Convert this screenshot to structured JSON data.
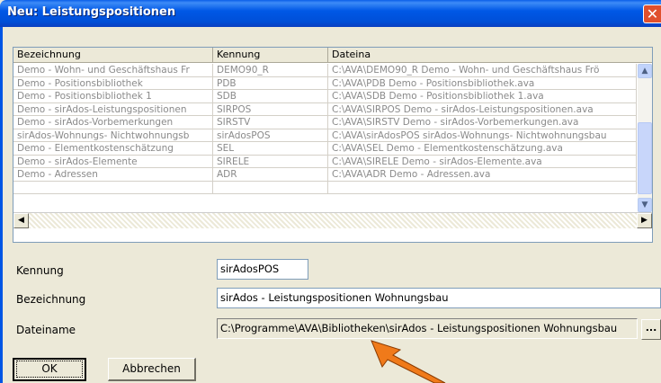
{
  "window": {
    "title": "Neu: Leistungspositionen",
    "close_glyph": "✕"
  },
  "list": {
    "columns": [
      "Bezeichnung",
      "Kennung",
      "Dateina"
    ],
    "rows": [
      [
        "Demo - Wohn- und Geschäftshaus Fr",
        "DEMO90_R",
        "C:\\AVA\\DEMO90_R Demo - Wohn- und Geschäftshaus Frö"
      ],
      [
        "Demo - Positionsbibliothek",
        "PDB",
        "C:\\AVA\\PDB Demo - Positionsbibliothek.ava"
      ],
      [
        "Demo - Positionsbibliothek 1",
        "SDB",
        "C:\\AVA\\SDB Demo - Positionsbibliothek 1.ava"
      ],
      [
        "Demo - sirAdos-Leistungspositionen",
        "SIRPOS",
        "C:\\AVA\\SIRPOS Demo - sirAdos-Leistungspositionen.ava"
      ],
      [
        "Demo - sirAdos-Vorbemerkungen",
        "SIRSTV",
        "C:\\AVA\\SIRSTV Demo - sirAdos-Vorbemerkungen.ava"
      ],
      [
        "sirAdos-Wohnungs- Nichtwohnungsb",
        "sirAdosPOS",
        "C:\\AVA\\sirAdosPOS sirAdos-Wohnungs- Nichtwohnungsbau"
      ],
      [
        "Demo - Elementkostenschätzung",
        "SEL",
        "C:\\AVA\\SEL Demo - Elementkostenschätzung.ava"
      ],
      [
        "Demo - sirAdos-Elemente",
        "SIRELE",
        "C:\\AVA\\SIRELE Demo - sirAdos-Elemente.ava"
      ],
      [
        "Demo - Adressen",
        "ADR",
        "C:\\AVA\\ADR Demo - Adressen.ava"
      ],
      [
        "",
        "",
        ""
      ]
    ]
  },
  "form": {
    "kennung_label": "Kennung",
    "kennung_value": "sirAdosPOS",
    "bezeichnung_label": "Bezeichnung",
    "bezeichnung_value": "sirAdos - Leistungspositionen Wohnungsbau",
    "dateiname_label": "Dateiname",
    "dateiname_value": "C:\\Programme\\AVA\\Bibliotheken\\sirAdos - Leistungspositionen Wohnungsbau",
    "browse_label": "..."
  },
  "buttons": {
    "ok": "OK",
    "cancel": "Abbrechen"
  },
  "colors": {
    "title_bar": "#0058E6",
    "arrow": "#F07A1A"
  }
}
